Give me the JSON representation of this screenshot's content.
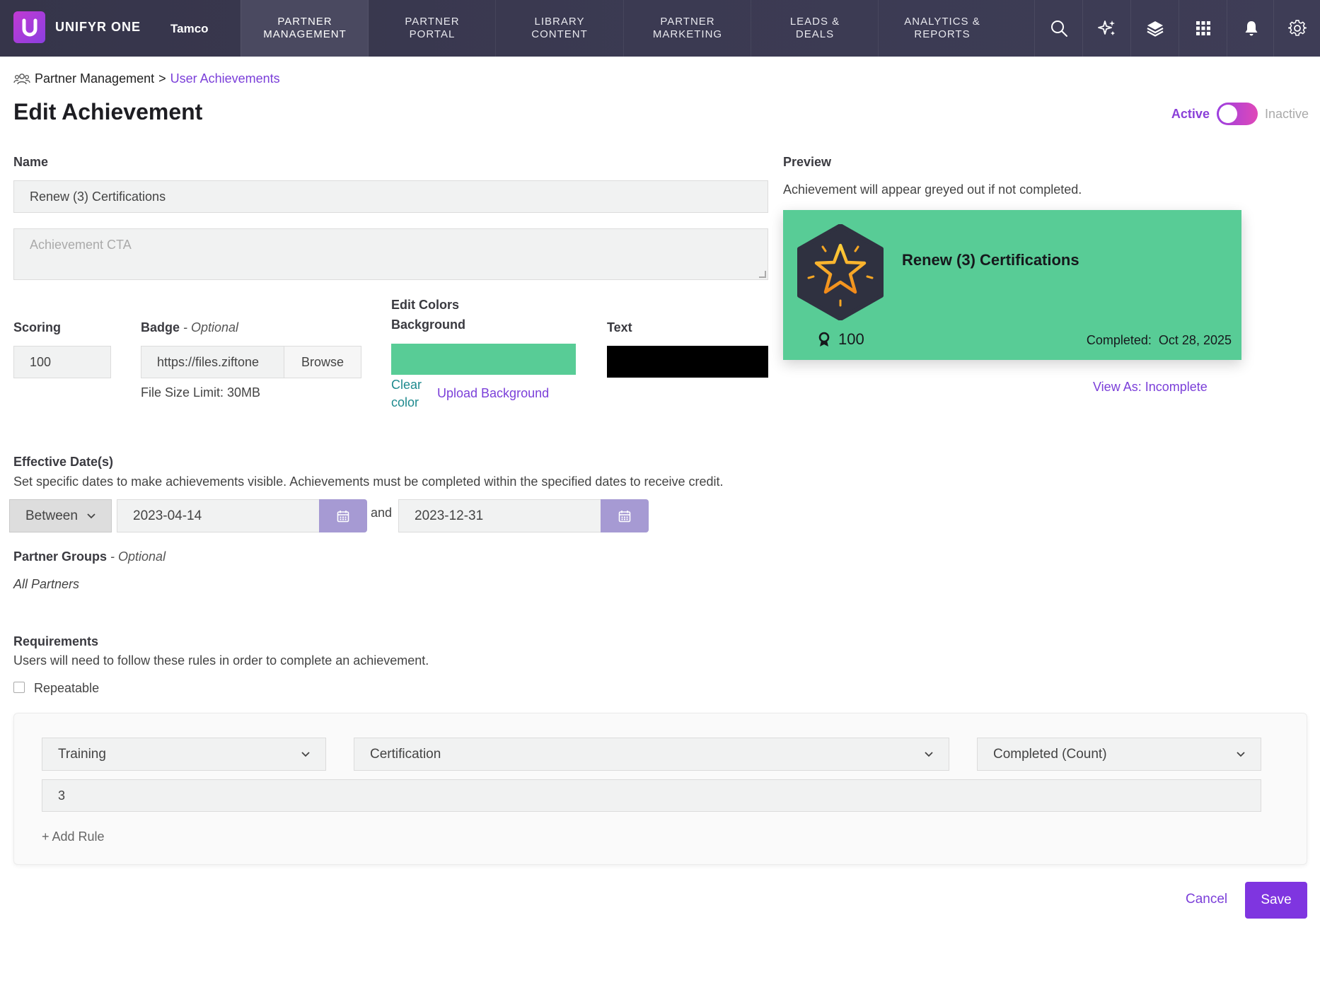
{
  "app": {
    "brand_name": "UNIFYR ONE",
    "tenant": "Tamco"
  },
  "nav": {
    "tabs": [
      {
        "line1": "PARTNER",
        "line2": "MANAGEMENT"
      },
      {
        "line1": "PARTNER",
        "line2": "PORTAL"
      },
      {
        "line1": "LIBRARY",
        "line2": "CONTENT"
      },
      {
        "line1": "PARTNER",
        "line2": "MARKETING"
      },
      {
        "line1": "LEADS &",
        "line2": "DEALS"
      },
      {
        "line1": "ANALYTICS &",
        "line2": "REPORTS"
      }
    ],
    "active_tab": "PARTNER MANAGEMENT",
    "icons": [
      "search-icon",
      "sparkle-icon",
      "layers-icon",
      "apps-grid-icon",
      "bell-icon",
      "gear-icon"
    ]
  },
  "breadcrumb": {
    "parent": "Partner Management",
    "separator": ">",
    "current": "User Achievements"
  },
  "page": {
    "title": "Edit Achievement",
    "status_active": "Active",
    "status_inactive": "Inactive",
    "status_on": true
  },
  "form": {
    "name_label": "Name",
    "name_value": "Renew (3) Certifications",
    "cta_placeholder": "Achievement CTA",
    "scoring_label": "Scoring",
    "scoring_value": "100",
    "badge_label": "Badge",
    "badge_optional": " - Optional",
    "badge_value": "https://files.ziftone",
    "browse_label": "Browse",
    "file_limit": "File Size Limit: 30MB",
    "edit_colors_label": "Edit Colors",
    "background_label": "Background",
    "background_color": "#58cc96",
    "clear_color_line1": "Clear",
    "clear_color_line2": "color",
    "upload_background": "Upload Background",
    "text_label": "Text",
    "text_color": "#000000"
  },
  "preview": {
    "label": "Preview",
    "note": "Achievement will appear greyed out if not completed.",
    "card_title": "Renew (3) Certifications",
    "card_score": "100",
    "completed_label": "Completed:",
    "completed_date": "Oct 28, 2025",
    "view_as": "View As: Incomplete"
  },
  "dates": {
    "label": "Effective Date(s)",
    "help": "Set specific dates to make achievements visible. Achievements must be completed within the specified dates to receive credit.",
    "mode": "Between",
    "start": "2023-04-14",
    "joiner": "and",
    "end": "2023-12-31"
  },
  "groups": {
    "label": "Partner Groups",
    "optional": " - Optional",
    "value": "All Partners"
  },
  "requirements": {
    "label": "Requirements",
    "help": "Users will need to follow these rules in order to complete an achievement.",
    "repeatable_label": "Repeatable",
    "repeatable_checked": false,
    "rule": {
      "category": "Training",
      "type": "Certification",
      "metric": "Completed (Count)",
      "value": "3"
    },
    "add_rule": "+ Add Rule"
  },
  "actions": {
    "cancel": "Cancel",
    "save": "Save"
  }
}
